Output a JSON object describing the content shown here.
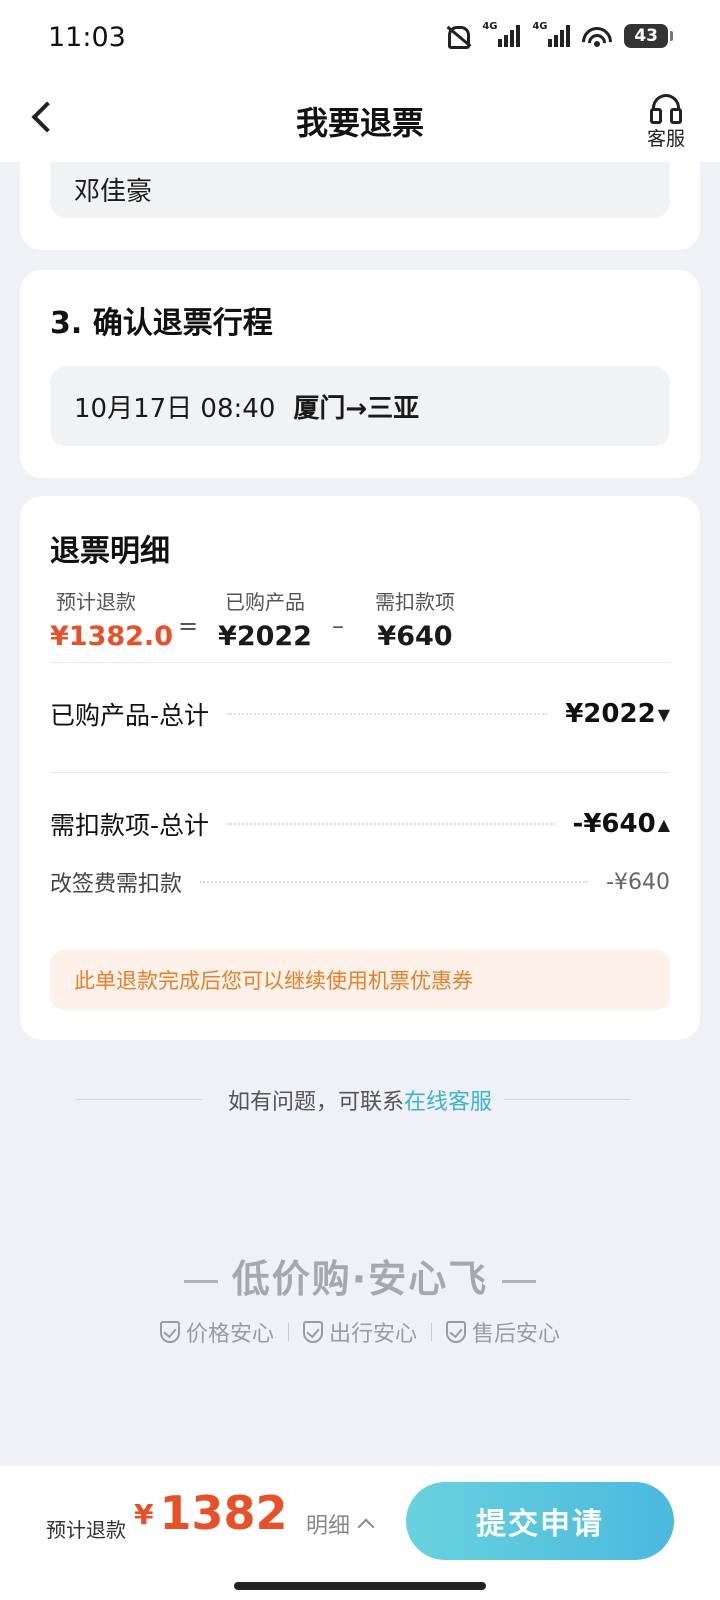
{
  "status_bar": {
    "time": "11:03",
    "network": "4G",
    "battery": "43"
  },
  "header": {
    "title": "我要退票",
    "service_label": "客服"
  },
  "passenger": {
    "name": "邓佳豪"
  },
  "trip": {
    "section_title": "3. 确认退票行程",
    "date_time": "10月17日 08:40",
    "route": "厦门→三亚"
  },
  "detail": {
    "section_title": "退票明细",
    "formula": {
      "refund_label": "预计退款",
      "refund_value": "¥1382.0",
      "eq": "=",
      "purchased_label": "已购产品",
      "purchased_value": "¥2022",
      "minus": "–",
      "deduct_label": "需扣款项",
      "deduct_value": "¥640"
    },
    "purchased_total_label": "已购产品-总计",
    "purchased_total_value": "¥2022",
    "deduct_total_label": "需扣款项-总计",
    "deduct_total_value": "-¥640",
    "change_fee_label": "改签费需扣款",
    "change_fee_value": "-¥640",
    "notice": "此单退款完成后您可以继续使用机票优惠券"
  },
  "contact": {
    "text": "如有问题，可联系",
    "link": "在线客服"
  },
  "slogan": {
    "text": "低价购·安心飞",
    "badges": [
      "价格安心",
      "出行安心",
      "售后安心"
    ]
  },
  "bottom_bar": {
    "est_label": "预计退款",
    "currency": "¥",
    "amount": "1382",
    "detail_label": "明细",
    "submit_label": "提交申请"
  },
  "colors": {
    "accent_red": "#e8502a",
    "link_blue": "#39b4d8",
    "button_start": "#68d2de",
    "button_end": "#4ab9de",
    "notice_text": "#e8802a"
  },
  "icons": {
    "back": "chevron-left-icon",
    "service": "headset-icon",
    "badge": "shield-check-icon",
    "expand": "caret-down-icon",
    "collapse": "caret-up-icon"
  }
}
